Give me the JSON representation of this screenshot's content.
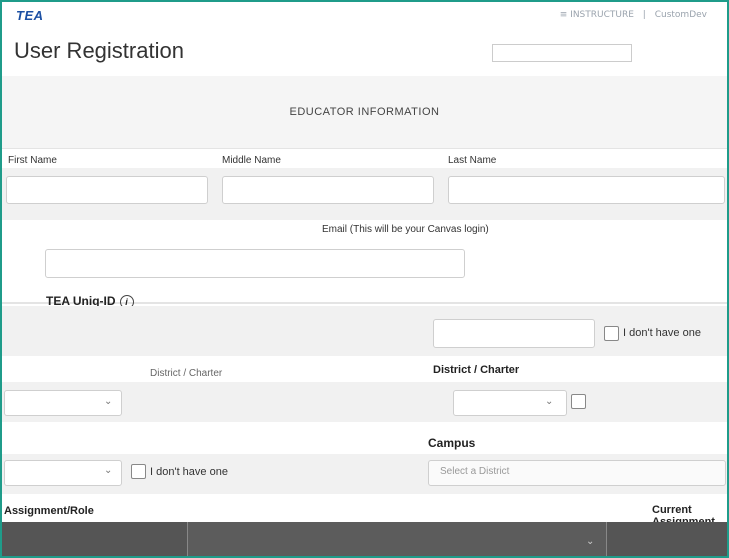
{
  "header": {
    "logo": "TEA",
    "brand": "INSTRUCTURE",
    "sub_brand": "CustomDev"
  },
  "title_row": {
    "title": "User Registration",
    "search_placeholder": "",
    "login_link": "",
    "help_link": ""
  },
  "section": {
    "title": "EDUCATOR INFORMATION"
  },
  "fields": {
    "first_name": "First Name",
    "middle_name": "Middle Name",
    "last_name": "Last Name",
    "date_of_birth": "",
    "email_label": "Email (This will be your Canvas login)",
    "tea_unique_id": "TEA Uniq-ID",
    "dont_have_one": "I don't have one",
    "district_charter_left": "District / Charter",
    "district_charter": "District / Charter",
    "campus": "Campus",
    "select_district": "Select a District",
    "assignment_role": "Assignment/Role",
    "current_assignment": "Current Assignment"
  },
  "colors": {
    "frame": "#1f9c8a",
    "accent_green": "#3f9f46",
    "logo_blue": "#1b4fa3",
    "bottom_bar": "#555555"
  }
}
